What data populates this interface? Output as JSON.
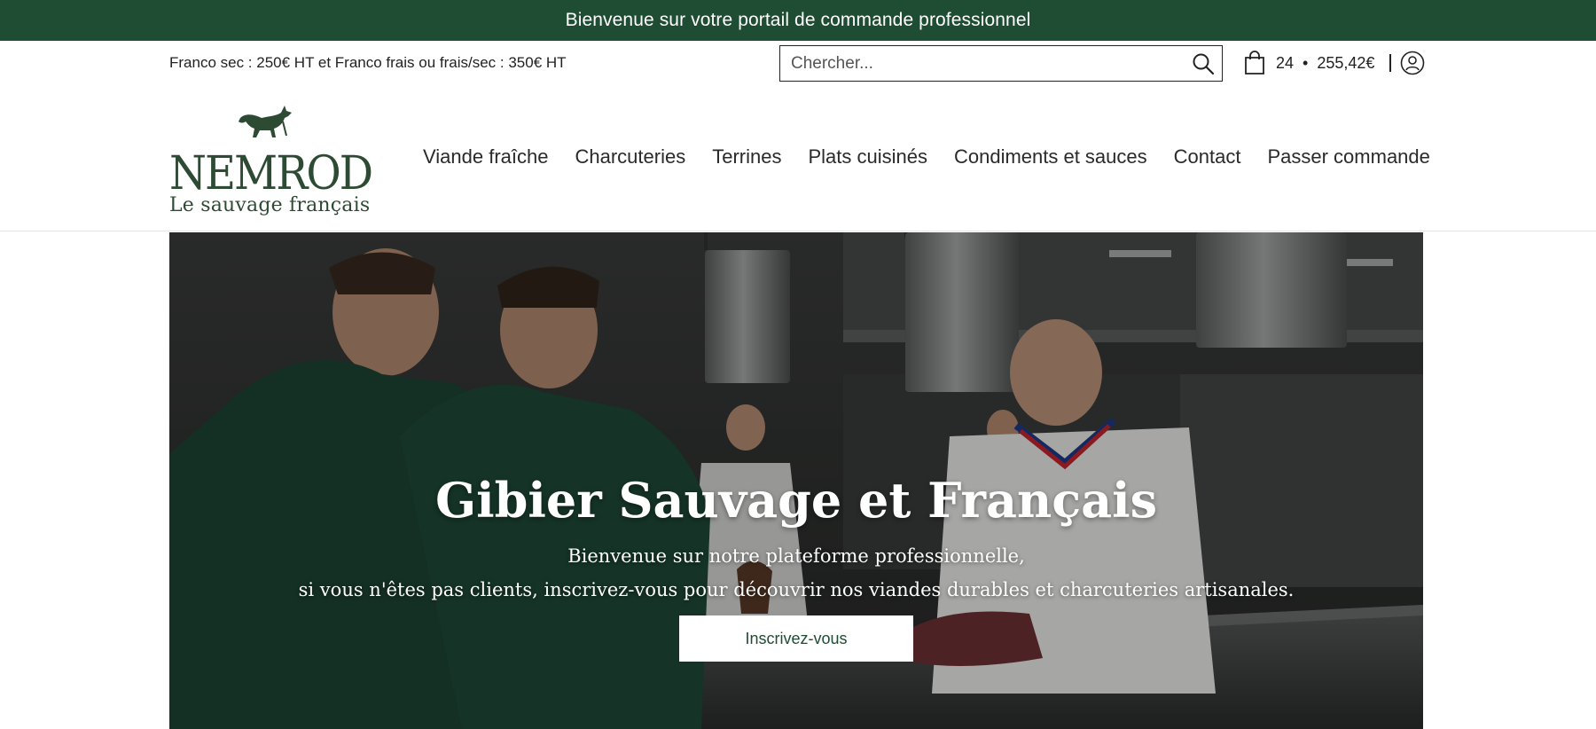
{
  "announcement": {
    "text": "Bienvenue sur votre portail de commande professionnel"
  },
  "utility": {
    "shipping_note": "Franco sec : 250€ HT et Franco frais ou frais/sec : 350€ HT",
    "search": {
      "placeholder": "Chercher...",
      "value": ""
    },
    "cart": {
      "count": "24",
      "separator": "•",
      "total": "255,42€"
    }
  },
  "header": {
    "logo": {
      "word": "NEMROD",
      "tagline": "Le sauvage français"
    },
    "nav": [
      {
        "label": "Viande fraîche"
      },
      {
        "label": "Charcuteries"
      },
      {
        "label": "Terrines"
      },
      {
        "label": "Plats cuisinés"
      },
      {
        "label": "Condiments et sauces"
      },
      {
        "label": "Contact"
      },
      {
        "label": "Passer commande"
      }
    ]
  },
  "hero": {
    "title": "Gibier Sauvage et Français",
    "line1": "Bienvenue sur notre plateforme professionnelle,",
    "line2": "si vous n'êtes pas clients, inscrivez-vous pour découvrir nos viandes durables et charcuteries artisanales.",
    "cta_label": "Inscrivez-vous"
  },
  "colors": {
    "brand_green": "#1f4d33",
    "logo_green": "#2d4a33"
  },
  "icons": [
    "search-icon",
    "shopping-bag-icon",
    "user-account-icon",
    "fox-logo-icon"
  ]
}
